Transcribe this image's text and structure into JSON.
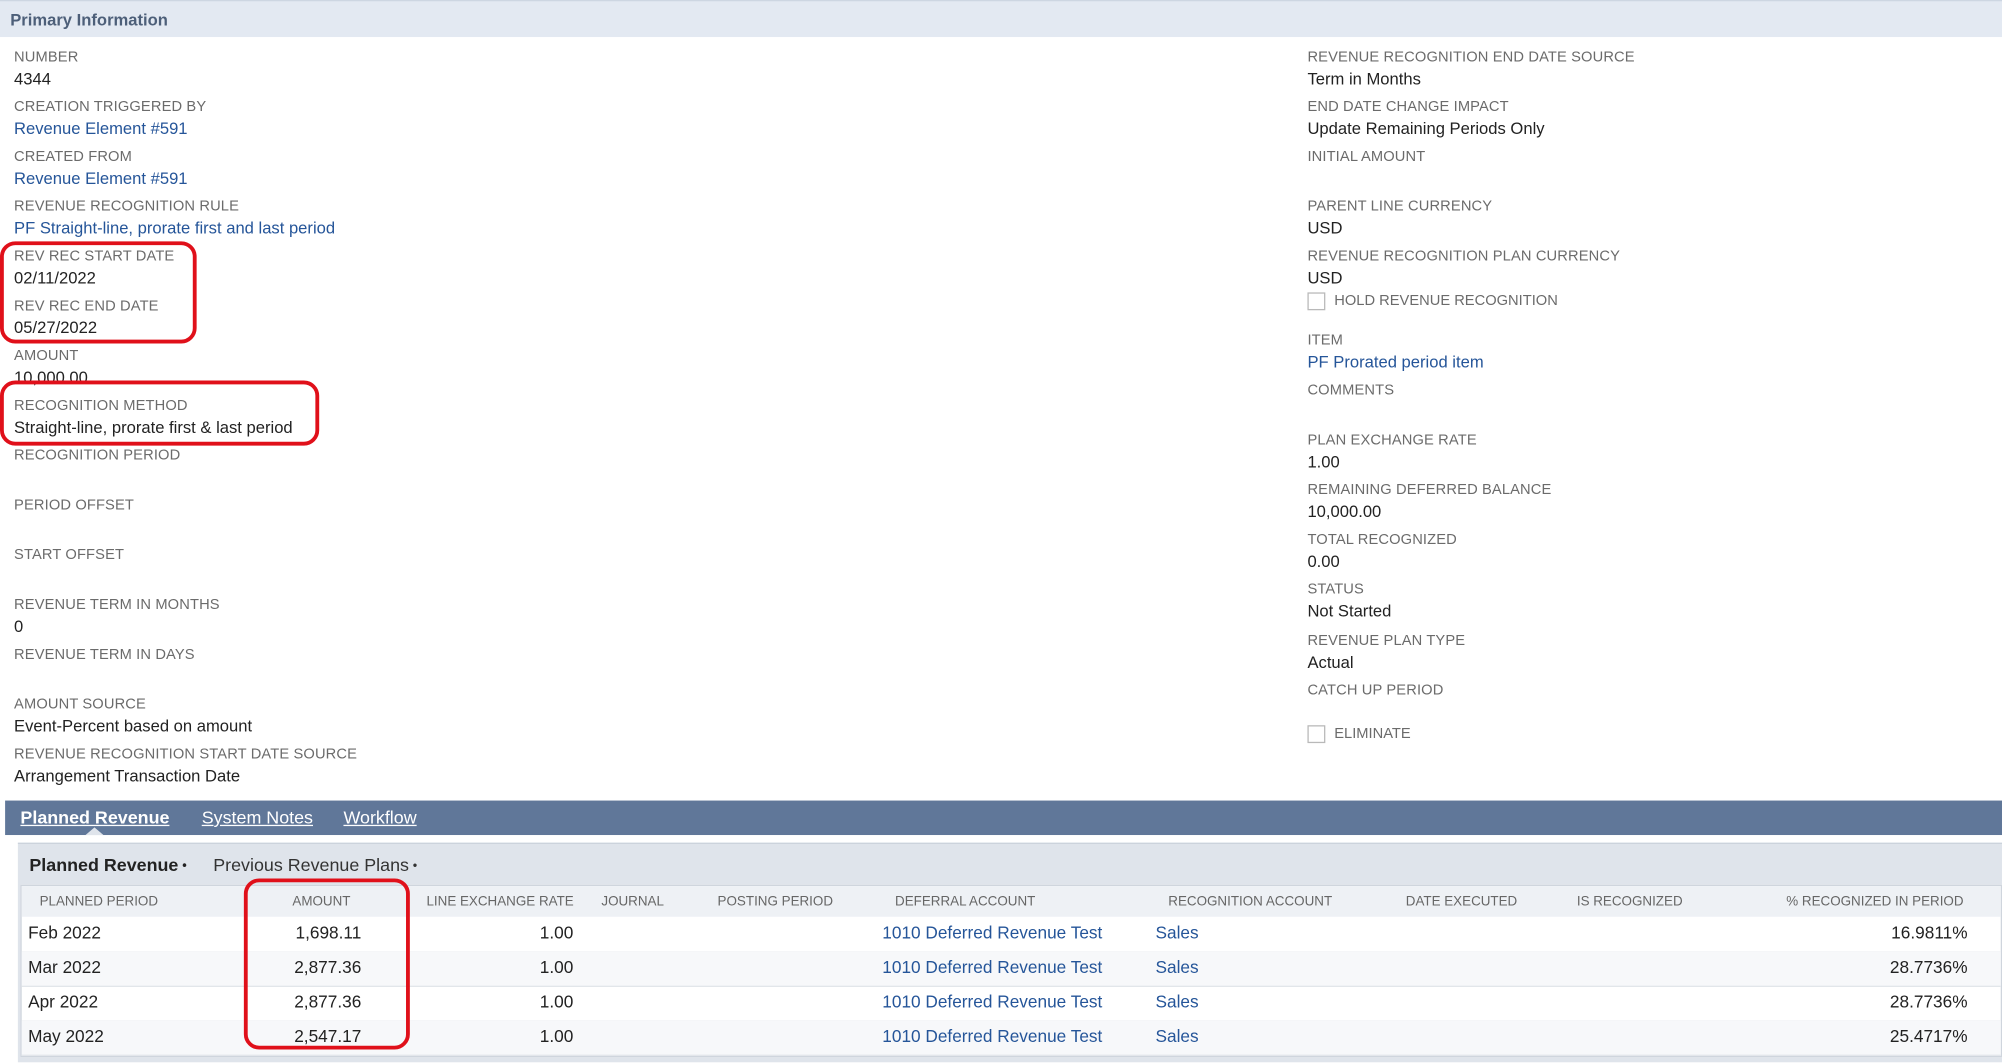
{
  "section": {
    "title": "Primary Information"
  },
  "left_fields": [
    {
      "label": "NUMBER",
      "value": "4344",
      "link": false
    },
    {
      "label": "CREATION TRIGGERED BY",
      "value": "Revenue Element #591",
      "link": true
    },
    {
      "label": "CREATED FROM",
      "value": "Revenue Element #591",
      "link": true
    },
    {
      "label": "REVENUE RECOGNITION RULE",
      "value": "PF Straight-line, prorate first and last period",
      "link": true
    },
    {
      "label": "REV REC START DATE",
      "value": "02/11/2022",
      "link": false
    },
    {
      "label": "REV REC END DATE",
      "value": "05/27/2022",
      "link": false
    },
    {
      "label": "AMOUNT",
      "value": "10,000.00",
      "link": false
    },
    {
      "label": "RECOGNITION METHOD",
      "value": "Straight-line, prorate first & last period",
      "link": false
    },
    {
      "label": "RECOGNITION PERIOD",
      "value": "",
      "link": false
    },
    {
      "label": "PERIOD OFFSET",
      "value": "",
      "link": false
    },
    {
      "label": "START OFFSET",
      "value": "",
      "link": false
    },
    {
      "label": "REVENUE TERM IN MONTHS",
      "value": "0",
      "link": false
    },
    {
      "label": "REVENUE TERM IN DAYS",
      "value": "",
      "link": false
    },
    {
      "label": "AMOUNT SOURCE",
      "value": "Event-Percent based on amount",
      "link": false
    },
    {
      "label": "REVENUE RECOGNITION START DATE SOURCE",
      "value": "Arrangement Transaction Date",
      "link": false
    }
  ],
  "right_fields": [
    {
      "label": "REVENUE RECOGNITION END DATE SOURCE",
      "value": "Term in Months",
      "link": false
    },
    {
      "label": "END DATE CHANGE IMPACT",
      "value": "Update Remaining Periods Only",
      "link": false
    },
    {
      "label": "INITIAL AMOUNT",
      "value": "",
      "link": false
    },
    {
      "label": "PARENT LINE CURRENCY",
      "value": "USD",
      "link": false
    },
    {
      "label": "REVENUE RECOGNITION PLAN CURRENCY",
      "value": "USD",
      "link": false
    },
    {
      "label": "ITEM",
      "value": "PF Prorated period item",
      "link": true
    },
    {
      "label": "COMMENTS",
      "value": "",
      "link": false
    },
    {
      "label": "PLAN EXCHANGE RATE",
      "value": "1.00",
      "link": false
    },
    {
      "label": "REMAINING DEFERRED BALANCE",
      "value": "10,000.00",
      "link": false
    },
    {
      "label": "TOTAL RECOGNIZED",
      "value": "0.00",
      "link": false
    },
    {
      "label": "STATUS",
      "value": "Not Started",
      "link": false
    },
    {
      "label": "REVENUE PLAN TYPE",
      "value": "Actual",
      "link": false
    },
    {
      "label": "CATCH UP PERIOD",
      "value": "",
      "link": false
    }
  ],
  "checkboxes": {
    "hold": {
      "label": "HOLD REVENUE RECOGNITION",
      "checked": false
    },
    "eliminate": {
      "label": "ELIMINATE",
      "checked": false
    }
  },
  "tabs": [
    "Planned Revenue",
    "System Notes",
    "Workflow"
  ],
  "subtabs": [
    {
      "label": "Planned Revenue",
      "marker": "•"
    },
    {
      "label": "Previous Revenue Plans",
      "marker": "•"
    }
  ],
  "grid": {
    "columns": [
      "PLANNED PERIOD",
      "AMOUNT",
      "LINE EXCHANGE RATE",
      "JOURNAL",
      "POSTING PERIOD",
      "DEFERRAL ACCOUNT",
      "RECOGNITION ACCOUNT",
      "DATE EXECUTED",
      "IS RECOGNIZED",
      "% RECOGNIZED IN PERIOD"
    ],
    "rows": [
      {
        "period": "Feb 2022",
        "amount": "1,698.11",
        "rate": "1.00",
        "journal": "",
        "posting": "",
        "deferral": "1010 Deferred Revenue Test",
        "recognition": "Sales",
        "executed": "",
        "recognized": "",
        "pct": "16.9811%"
      },
      {
        "period": "Mar 2022",
        "amount": "2,877.36",
        "rate": "1.00",
        "journal": "",
        "posting": "",
        "deferral": "1010 Deferred Revenue Test",
        "recognition": "Sales",
        "executed": "",
        "recognized": "",
        "pct": "28.7736%"
      },
      {
        "period": "Apr 2022",
        "amount": "2,877.36",
        "rate": "1.00",
        "journal": "",
        "posting": "",
        "deferral": "1010 Deferred Revenue Test",
        "recognition": "Sales",
        "executed": "",
        "recognized": "",
        "pct": "28.7736%"
      },
      {
        "period": "May 2022",
        "amount": "2,547.17",
        "rate": "1.00",
        "journal": "",
        "posting": "",
        "deferral": "1010 Deferred Revenue Test",
        "recognition": "Sales",
        "executed": "",
        "recognized": "",
        "pct": "25.4717%"
      }
    ]
  },
  "colors": {
    "link": "#255599",
    "tabbar": "#607799",
    "highlight": "#e0101a",
    "header_bg": "#e3e9f2"
  }
}
